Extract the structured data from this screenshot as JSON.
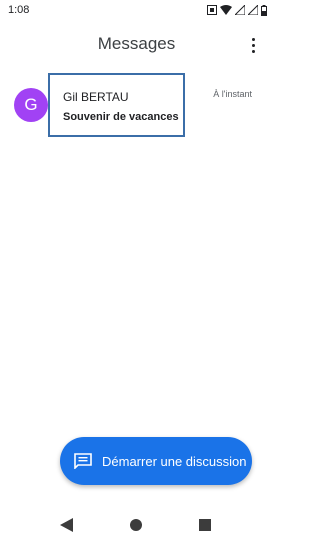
{
  "status_bar": {
    "time": "1:08",
    "icons": [
      "screenshot-icon",
      "wifi-icon",
      "signal-icon",
      "signal-icon",
      "battery-icon"
    ]
  },
  "app_bar": {
    "title": "Messages",
    "overflow_icon": "more-vert-icon"
  },
  "conversations": [
    {
      "avatar_letter": "G",
      "avatar_color": "#a142f4",
      "name": "Gil BERTAU",
      "snippet": "Souvenir de vacances",
      "time": "À l'instant"
    }
  ],
  "fab": {
    "icon": "chat-icon",
    "label": "Démarrer une discussion",
    "color": "#1a73e8"
  },
  "nav_bar": {
    "icons": [
      "back-icon",
      "home-icon",
      "recents-icon"
    ]
  }
}
